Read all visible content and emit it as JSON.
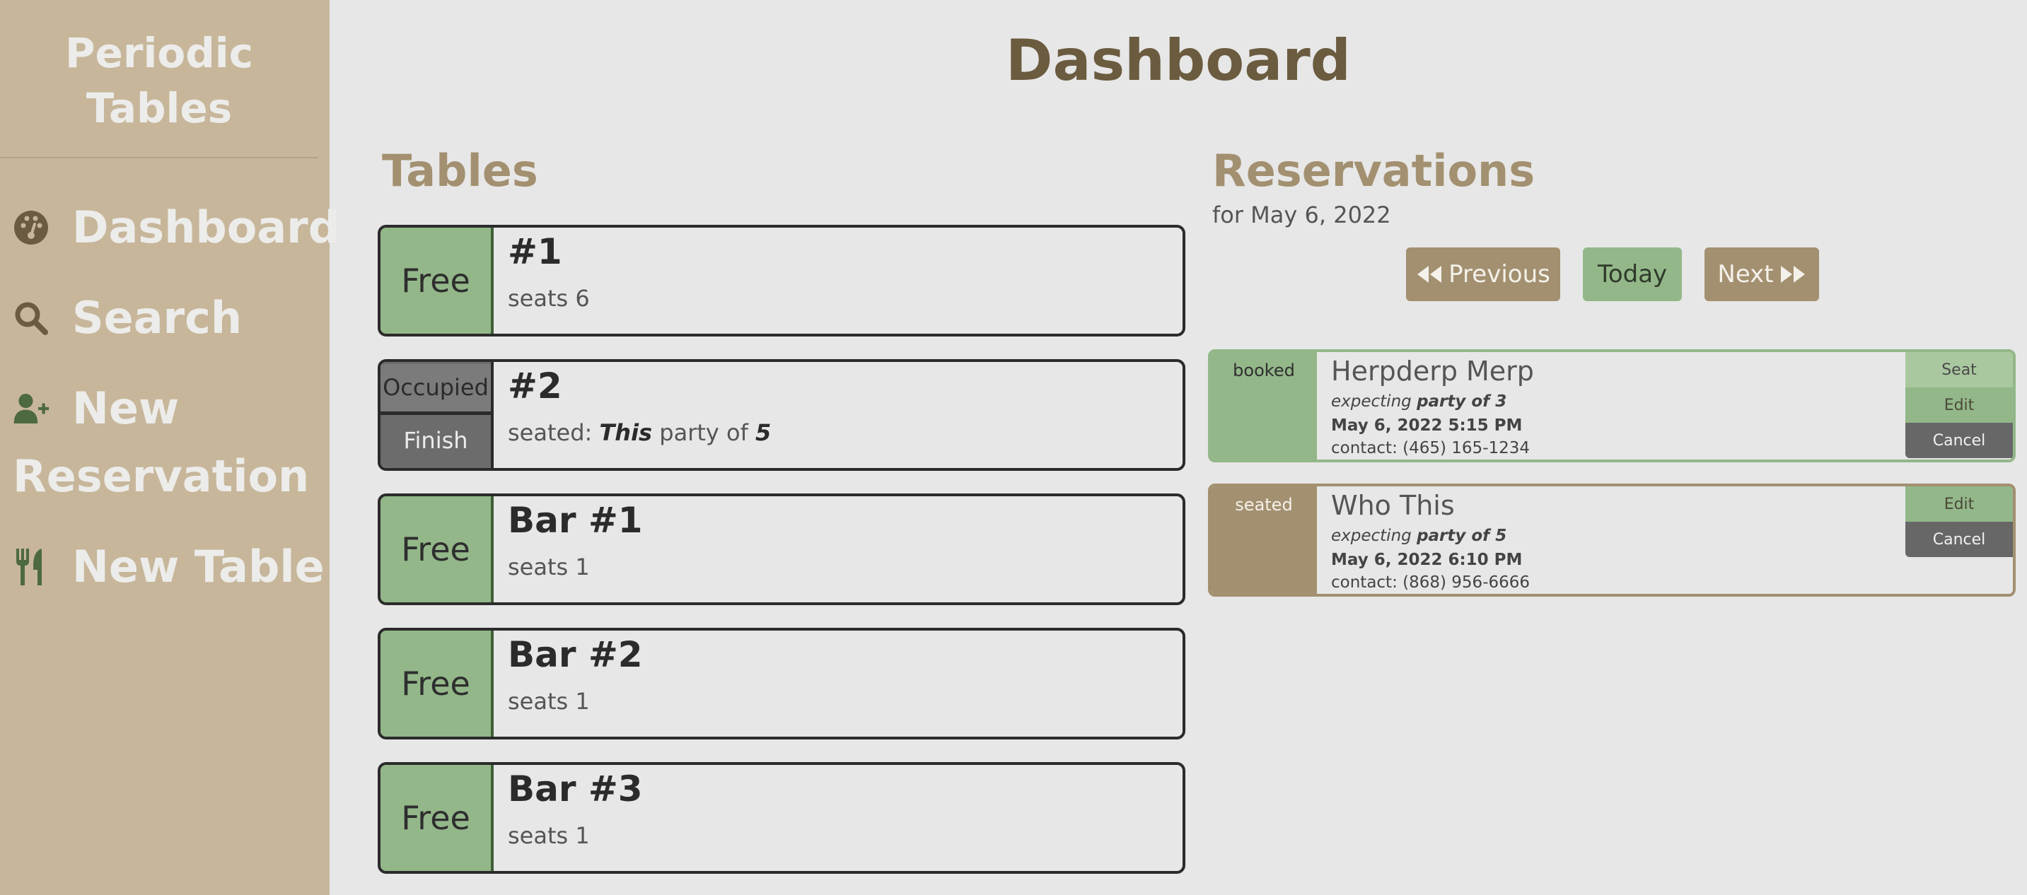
{
  "sidebar": {
    "brand_line1": "Periodic",
    "brand_line2": "Tables",
    "items": [
      {
        "label": "Dashboard",
        "icon": "dashboard-icon"
      },
      {
        "label": "Search",
        "icon": "search-icon"
      },
      {
        "label_line1": "New",
        "label_line2": "Reservation",
        "icon": "add-user-icon"
      },
      {
        "label": "New Table",
        "icon": "utensils-icon"
      }
    ]
  },
  "page": {
    "title": "Dashboard"
  },
  "tables_section": {
    "title": "Tables",
    "tables": [
      {
        "status": "Free",
        "name": "#1",
        "sub": "seats 6"
      },
      {
        "status": "Occupied",
        "finish": "Finish",
        "name": "#2",
        "seated_prefix": "seated:",
        "seated_name": "This",
        "seated_mid": "party of",
        "seated_size": "5"
      },
      {
        "status": "Free",
        "name": "Bar #1",
        "sub": "seats 1"
      },
      {
        "status": "Free",
        "name": "Bar #2",
        "sub": "seats 1"
      },
      {
        "status": "Free",
        "name": "Bar #3",
        "sub": "seats 1"
      }
    ]
  },
  "reservations_section": {
    "title": "Reservations",
    "date_label": "for May 6, 2022",
    "buttons": {
      "previous": "Previous",
      "today": "Today",
      "next": "Next"
    },
    "reservations": [
      {
        "status": "booked",
        "name": "Herpderp Merp",
        "party_prefix": "expecting",
        "party": "party of 3",
        "time": "May 6, 2022 5:15 PM",
        "contact": "contact: (465) 165-1234",
        "actions": {
          "seat": "Seat",
          "edit": "Edit",
          "cancel": "Cancel"
        }
      },
      {
        "status": "seated",
        "name": "Who This",
        "party_prefix": "expecting",
        "party": "party of 5",
        "time": "May 6, 2022 6:10 PM",
        "contact": "contact: (868) 956-6666",
        "actions": {
          "edit": "Edit",
          "cancel": "Cancel"
        }
      }
    ]
  },
  "colors": {
    "sidebar_bg": "#c7b69a",
    "page_bg": "#e7e7e7",
    "accent_tan": "#a39070",
    "accent_green": "#93b789",
    "title_brown": "#6b5b3f"
  }
}
